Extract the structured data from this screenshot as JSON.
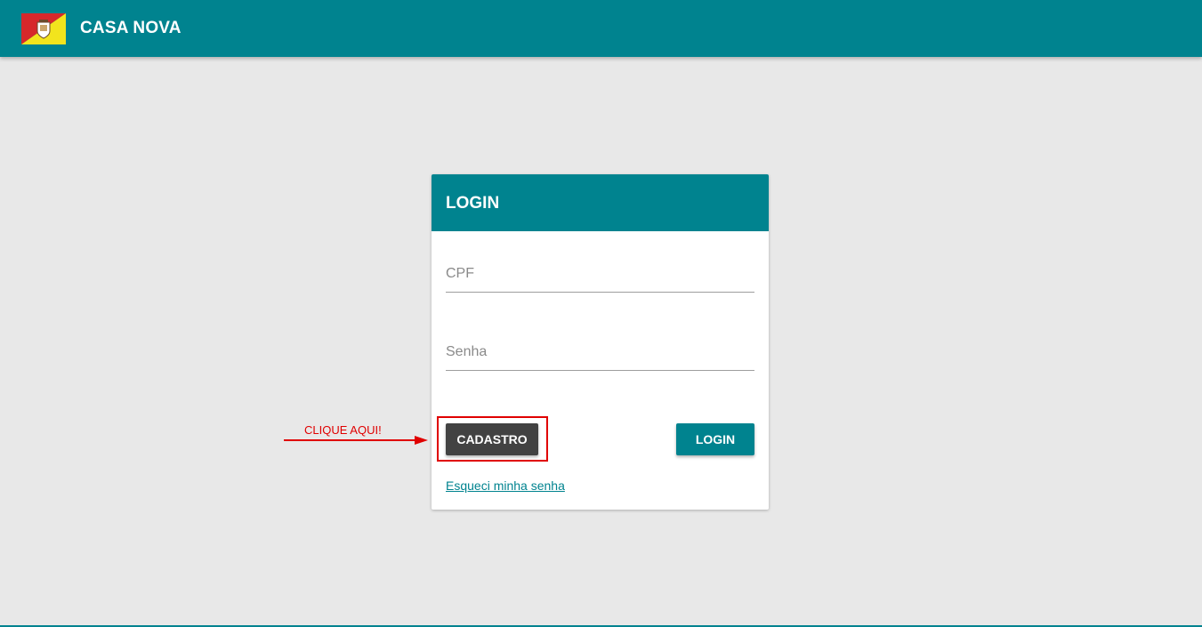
{
  "header": {
    "app_title": "CASA NOVA",
    "logo_icon": "city-flag-logo-icon"
  },
  "login_card": {
    "title": "LOGIN",
    "cpf_placeholder": "CPF",
    "cpf_value": "",
    "senha_placeholder": "Senha",
    "senha_value": "",
    "cadastro_label": "CADASTRO",
    "login_label": "LOGIN",
    "forgot_label": "Esqueci minha senha"
  },
  "annotation": {
    "text": "CLIQUE AQUI!",
    "arrow_icon": "arrow-right-icon"
  },
  "colors": {
    "primary": "#00838f",
    "dark_button": "#424242",
    "background": "#e8e8e8",
    "annotation_red": "#e00000"
  }
}
